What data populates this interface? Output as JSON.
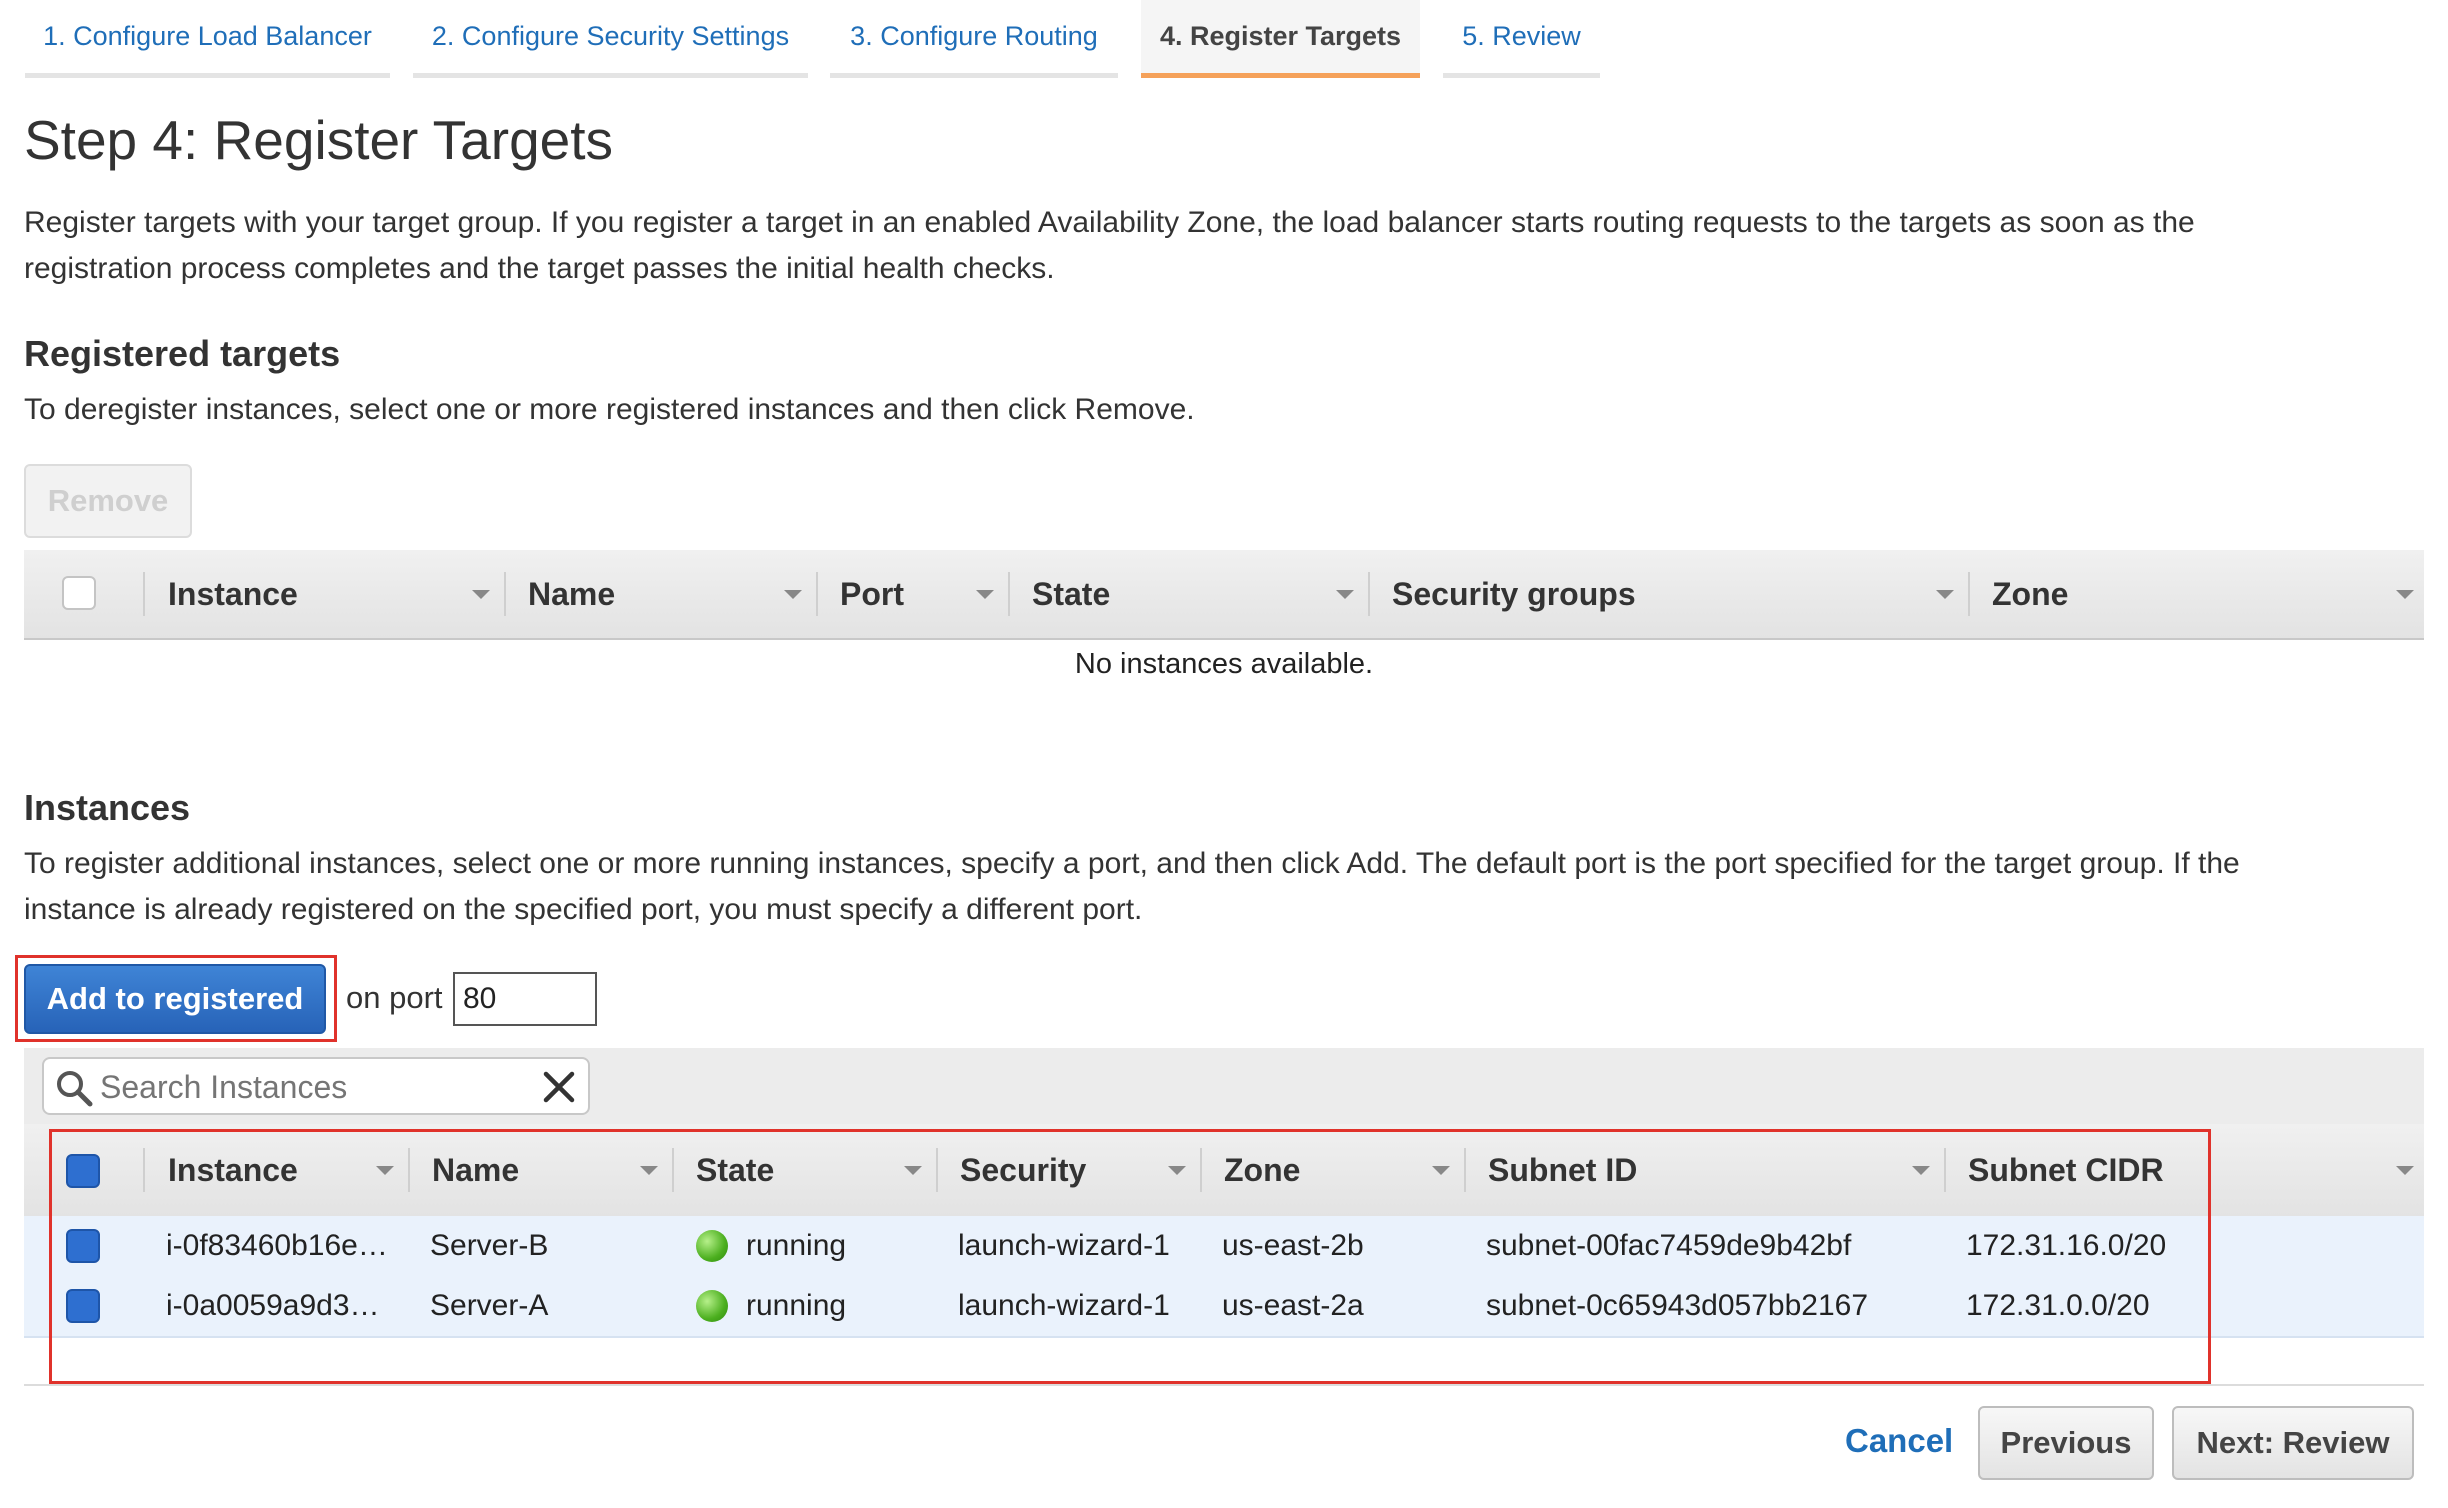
{
  "wizard": {
    "tabs": [
      {
        "label": "1. Configure Load Balancer"
      },
      {
        "label": "2. Configure Security Settings"
      },
      {
        "label": "3. Configure Routing"
      },
      {
        "label": "4. Register Targets",
        "active": true
      },
      {
        "label": "5. Review"
      }
    ]
  },
  "page": {
    "title": "Step 4: Register Targets",
    "intro_line1": "Register targets with your target group. If you register a target in an enabled Availability Zone, the load balancer starts routing requests to the targets as soon as the",
    "intro_line2": "registration process completes and the target passes the initial health checks."
  },
  "registered": {
    "heading": "Registered targets",
    "description": "To deregister instances, select one or more registered instances and then click Remove.",
    "remove_label": "Remove",
    "columns": [
      "Instance",
      "Name",
      "Port",
      "State",
      "Security groups",
      "Zone"
    ],
    "empty_message": "No instances available."
  },
  "instances": {
    "heading": "Instances",
    "desc_line1": "To register additional instances, select one or more running instances, specify a port, and then click Add. The default port is the port specified for the target group. If the",
    "desc_line2": "instance is already registered on the specified port, you must specify a different port.",
    "add_label": "Add to registered",
    "on_port_label": "on port",
    "port_value": "80",
    "search_placeholder": "Search Instances",
    "columns": [
      "Instance",
      "Name",
      "State",
      "Security",
      "Zone",
      "Subnet ID",
      "Subnet CIDR"
    ],
    "rows": [
      {
        "instance": "i-0f83460b16e…",
        "name": "Server-B",
        "state": "running",
        "security": "launch-wizard-1",
        "zone": "us-east-2b",
        "subnet_id": "subnet-00fac7459de9b42bf",
        "subnet_cidr": "172.31.16.0/20"
      },
      {
        "instance": "i-0a0059a9d3…",
        "name": "Server-A",
        "state": "running",
        "security": "launch-wizard-1",
        "zone": "us-east-2a",
        "subnet_id": "subnet-0c65943d057bb2167",
        "subnet_cidr": "172.31.0.0/20"
      }
    ]
  },
  "footer": {
    "cancel_label": "Cancel",
    "previous_label": "Previous",
    "next_label": "Next: Review"
  },
  "colors": {
    "accent_blue": "#2763b8",
    "link_blue": "#1f6eb8",
    "highlight_red": "#e0322b",
    "active_tab_underline": "#f5a15a",
    "running_green": "#4caf1f"
  }
}
